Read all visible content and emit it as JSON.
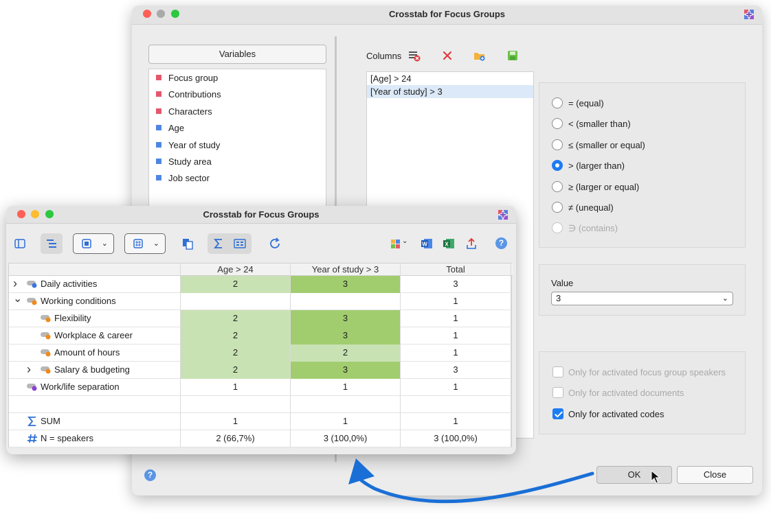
{
  "back_dialog": {
    "title": "Crosstab for Focus Groups",
    "variables_button": "Variables",
    "variables": [
      {
        "label": "Focus group",
        "color": "#e4576b"
      },
      {
        "label": "Contributions",
        "color": "#e4576b"
      },
      {
        "label": "Characters",
        "color": "#e4576b"
      },
      {
        "label": "Age",
        "color": "#4f86e4"
      },
      {
        "label": "Year of study",
        "color": "#4f86e4"
      },
      {
        "label": "Study area",
        "color": "#4f86e4"
      },
      {
        "label": "Job sector",
        "color": "#4f86e4"
      }
    ],
    "columns_label": "Columns",
    "columns": [
      "[Age] > 24",
      "[Year of study] > 3"
    ],
    "selected_column_index": 1,
    "operators": [
      {
        "label": "= (equal)",
        "checked": false,
        "disabled": false
      },
      {
        "label": "< (smaller than)",
        "checked": false,
        "disabled": false
      },
      {
        "label": "≤ (smaller or equal)",
        "checked": false,
        "disabled": false
      },
      {
        "label": "> (larger than)",
        "checked": true,
        "disabled": false
      },
      {
        "label": "≥ (larger or equal)",
        "checked": false,
        "disabled": false
      },
      {
        "label": "≠ (unequal)",
        "checked": false,
        "disabled": false
      },
      {
        "label": "∋ (contains)",
        "checked": false,
        "disabled": true
      }
    ],
    "value_label": "Value",
    "value_selected": "3",
    "options": [
      {
        "label": "Only for activated focus group speakers",
        "checked": false,
        "disabled": true
      },
      {
        "label": "Only for activated documents",
        "checked": false,
        "disabled": true
      },
      {
        "label": "Only for activated codes",
        "checked": true,
        "disabled": false
      }
    ],
    "ok_label": "OK",
    "close_label": "Close",
    "help_glyph": "?"
  },
  "front_window": {
    "title": "Crosstab for Focus Groups",
    "help_glyph": "?",
    "table": {
      "headers": [
        "",
        "Age > 24",
        "Year of study > 3",
        "Total"
      ],
      "rows": [
        {
          "label": "Daily activities",
          "indent": 0,
          "toggle": "›",
          "icon": "code-blue-icon",
          "cells": [
            "2",
            "3",
            "3"
          ],
          "heat": [
            "light",
            "strong",
            "none"
          ]
        },
        {
          "label": "Working conditions",
          "indent": 0,
          "toggle": "⌄",
          "icon": "code-orange-icon",
          "cells": [
            "",
            "",
            "1"
          ],
          "heat": [
            "none",
            "none",
            "none"
          ]
        },
        {
          "label": "Flexibility",
          "indent": 1,
          "toggle": "",
          "icon": "code-orange-icon",
          "cells": [
            "2",
            "3",
            "1"
          ],
          "heat": [
            "light",
            "strong",
            "none"
          ]
        },
        {
          "label": "Workplace & career",
          "indent": 1,
          "toggle": "",
          "icon": "code-orange-icon",
          "cells": [
            "2",
            "3",
            "1"
          ],
          "heat": [
            "light",
            "strong",
            "none"
          ]
        },
        {
          "label": "Amount of hours",
          "indent": 1,
          "toggle": "",
          "icon": "code-orange-icon",
          "cells": [
            "2",
            "2",
            "1"
          ],
          "heat": [
            "light",
            "light",
            "none"
          ]
        },
        {
          "label": "Salary & budgeting",
          "indent": 1,
          "toggle": "›",
          "icon": "code-orange-icon",
          "cells": [
            "2",
            "3",
            "3"
          ],
          "heat": [
            "light",
            "strong",
            "none"
          ]
        },
        {
          "label": "Work/life separation",
          "indent": 0,
          "toggle": "",
          "icon": "code-purple-icon",
          "cells": [
            "1",
            "1",
            "1"
          ],
          "heat": [
            "none",
            "none",
            "none"
          ]
        },
        {
          "label": "",
          "indent": 0,
          "toggle": "",
          "icon": "",
          "cells": [
            "",
            "",
            ""
          ],
          "heat": [
            "none",
            "none",
            "none"
          ]
        },
        {
          "label": "SUM",
          "indent": 0,
          "toggle": "",
          "icon": "sum-icon",
          "cells": [
            "1",
            "1",
            "1"
          ],
          "heat": [
            "none",
            "none",
            "none"
          ]
        },
        {
          "label": "N = speakers",
          "indent": 0,
          "toggle": "",
          "icon": "hash-icon",
          "cells": [
            "2 (66,7%)",
            "3 (100,0%)",
            "3 (100,0%)"
          ],
          "heat": [
            "none",
            "none",
            "none"
          ]
        }
      ]
    }
  },
  "colors": {
    "heat_light": "#c9e2b3",
    "heat_strong": "#a1cd6f",
    "accent_blue": "#1d7cf2",
    "arrow_blue": "#1a6fd6"
  }
}
